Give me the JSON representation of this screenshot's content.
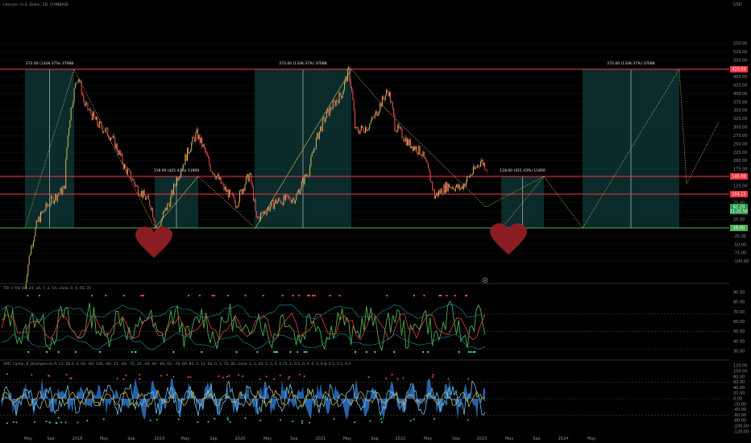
{
  "header": {
    "symbol_title": "Litecoin / U.S. Dollar, 1D, COINBASE",
    "currency": "USD",
    "rsi_title": "TDI + RSI Div 24, 34, 7, 2, 14, close, 0, 0, 65, 35",
    "osc_title": "VMC Cipher_B_Divergences 9, 12, 50.0, 0, 60, -60, 100, -80, 53, -40, -75, 20, -40, 40, -60, 65, -70, 60, 80, 5, 14, 60, 0, 3, 70, 30, close, 1, 1, 20, 5, 5, 0, 0.75, 1, 0.5, 0, 0, 0, 0, 0.8, 0.5, 0.5, 0.4"
  },
  "annotations": {
    "zone1_label": "272.00 (1328.37%) 37088",
    "zone2_label": "118.00 (421.43%) 11800",
    "zone3_label": "272.00 (1328.37%) 37088",
    "zone4_label": "118.00 (421.43%) 11800",
    "zone5_label": "272.00 (1328.37%) 37088"
  },
  "price_tags": {
    "resistance_top": "420.50",
    "level_high": "145.00",
    "level_mid": "104.15",
    "current_price": "61.29",
    "current_countdown": "21:21:56",
    "support": "28.00"
  },
  "colors": {
    "background": "#000000",
    "grid": "#131722",
    "zone_fill": "#0f3a3a",
    "red_line": "#f23645",
    "green_line": "#4caf50",
    "candle_up": "#26a69a",
    "candle_down": "#ef5350",
    "projection": "#c9b04a",
    "heart": "#8b1d22",
    "rsi_green": "#4caf50",
    "rsi_red": "#e0463c",
    "cipher_blue": "#2a73c9",
    "cipher_light": "#6fc3e8",
    "cipher_yellow": "#f2c12e"
  },
  "icons": [
    "heart-icon",
    "settings-gear-icon"
  ],
  "chart_data": [
    {
      "type": "line",
      "name": "price",
      "y_scale": "log",
      "x_labels": [
        "May",
        "Sep",
        "2018",
        "May",
        "Sep",
        "2019",
        "May",
        "Sep",
        "2020",
        "May",
        "Sep",
        "2021",
        "May",
        "Sep",
        "2022",
        "May",
        "Sep",
        "2023",
        "May",
        "Sep",
        "2024",
        "May"
      ],
      "y_ticks": [
        "550.00",
        "525.00",
        "500.00",
        "475.00",
        "450.00",
        "425.00",
        "400.00",
        "375.00",
        "350.00",
        "325.00",
        "300.00",
        "275.00",
        "250.00",
        "225.00",
        "200.00",
        "175.00",
        "150.00",
        "125.00",
        "100.00",
        "75.00",
        "50.00",
        "25.00",
        "0.00",
        "-25.00",
        "-50.00",
        "-75.00",
        "-100.00"
      ],
      "close_series": [
        [
          "2017-04",
          10
        ],
        [
          "2017-06",
          32
        ],
        [
          "2017-08",
          45
        ],
        [
          "2017-10",
          55
        ],
        [
          "2017-12",
          380
        ],
        [
          "2018-01",
          230
        ],
        [
          "2018-03",
          165
        ],
        [
          "2018-05",
          135
        ],
        [
          "2018-07",
          80
        ],
        [
          "2018-09",
          55
        ],
        [
          "2018-11",
          42
        ],
        [
          "2018-12",
          26
        ],
        [
          "2019-02",
          45
        ],
        [
          "2019-04",
          85
        ],
        [
          "2019-06",
          140
        ],
        [
          "2019-08",
          80
        ],
        [
          "2019-10",
          56
        ],
        [
          "2019-12",
          42
        ],
        [
          "2020-02",
          70
        ],
        [
          "2020-03",
          32
        ],
        [
          "2020-06",
          44
        ],
        [
          "2020-09",
          47
        ],
        [
          "2020-11",
          75
        ],
        [
          "2021-01",
          165
        ],
        [
          "2021-02",
          205
        ],
        [
          "2021-04",
          280
        ],
        [
          "2021-05",
          410
        ],
        [
          "2021-06",
          145
        ],
        [
          "2021-08",
          160
        ],
        [
          "2021-09",
          190
        ],
        [
          "2021-11",
          295
        ],
        [
          "2021-12",
          160
        ],
        [
          "2022-02",
          120
        ],
        [
          "2022-04",
          102
        ],
        [
          "2022-06",
          48
        ],
        [
          "2022-08",
          58
        ],
        [
          "2022-10",
          55
        ],
        [
          "2022-12",
          75
        ],
        [
          "2023-01",
          88
        ],
        [
          "2023-02",
          78
        ]
      ],
      "horizontal_levels": [
        420.5,
        145.0,
        104.15,
        28.0
      ],
      "current_price": 61.29,
      "projection": [
        [
          "2023-02",
          80
        ],
        [
          "2023-09",
          28
        ],
        [
          "2024-06",
          420.5
        ],
        [
          "2024-07",
          130
        ],
        [
          "2024-09",
          240
        ]
      ],
      "zones": [
        {
          "label": "272.00 (1328.37%) 37088",
          "from": "2017-04",
          "to": "2018-03"
        },
        {
          "label": "118.00 (421.43%) 11800",
          "from": "2018-12",
          "to": "2019-08"
        },
        {
          "label": "272.00 (1328.37%) 37088",
          "from": "2020-03",
          "to": "2021-05"
        },
        {
          "label": "118.00 (421.43%) 11800",
          "from": "2022-11",
          "to": "2023-06"
        },
        {
          "label": "272.00 (1328.37%) 37088",
          "from": "2023-09",
          "to": "2024-06"
        }
      ]
    },
    {
      "type": "line",
      "name": "TDI + RSI",
      "y_ticks": [
        "90.00",
        "80.00",
        "70.00",
        "60.00",
        "50.00",
        "40.00",
        "30.00"
      ],
      "ylim": [
        25,
        95
      ],
      "reference_lines": [
        68,
        50,
        32
      ]
    },
    {
      "type": "area",
      "name": "VMC Cipher_B",
      "y_ticks": [
        "120.00",
        "100.00",
        "80.00",
        "60.00",
        "40.00",
        "20.00",
        "0.00",
        "-20.00",
        "-40.00",
        "-60.00",
        "-80.00",
        "-100.00",
        "-120.00"
      ],
      "ylim": [
        -120,
        120
      ],
      "reference_lines": [
        60,
        0,
        -60
      ]
    }
  ]
}
